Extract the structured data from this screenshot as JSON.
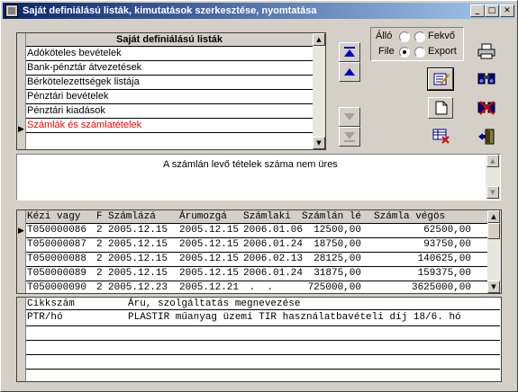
{
  "window": {
    "title": "Saját definiálású listák, kimutatások szerkesztése, nyomtatása",
    "controls": {
      "minimize": "_",
      "maximize": "□",
      "close": "✕"
    }
  },
  "lists": {
    "header": "Saját definiálású listák",
    "items": [
      "Adóköteles bevételek",
      "Bank-pénztár átvezetések",
      "Bérkötelezettségek listája",
      "Pénztári bevételek",
      "Pénztári kiadások",
      "Számlák és számlatételek"
    ],
    "selected_index": 5
  },
  "output": {
    "allo_label": "Álló",
    "fekvo_label": "Fekvő",
    "file_label": "File",
    "export_label": "Export",
    "orientation_selected": "Álló",
    "target_selected": "File"
  },
  "toolbar": {
    "icons": [
      "print-icon",
      "edit-icon",
      "binoculars-icon",
      "new-document-icon",
      "filter-binoculars-icon",
      "delete-record-icon",
      "exit-door-icon"
    ]
  },
  "memo": {
    "text": "A számlán levő tételek száma nem üres"
  },
  "invoices": {
    "columns": [
      "Kézi vagy",
      "F",
      "Számlázá",
      "Árumozgá",
      "Számlaki",
      "Számlán lé",
      "Számla végös"
    ],
    "rows": [
      [
        "T050000086",
        "2",
        "2005.12.15",
        "2005.12.15",
        "2006.01.06",
        "12500,00",
        "62500,00"
      ],
      [
        "T050000087",
        "2",
        "2005.12.15",
        "2005.12.15",
        "2006.01.24",
        "18750,00",
        "93750,00"
      ],
      [
        "T050000088",
        "2",
        "2005.12.15",
        "2005.12.15",
        "2006.02.13",
        "28125,00",
        "140625,00"
      ],
      [
        "T050000089",
        "2",
        "2005.12.15",
        "2005.12.15",
        "2006.01.24",
        "31875,00",
        "159375,00"
      ],
      [
        "T050000090",
        "2",
        "2005.12.23",
        "2005.12.21",
        " .  .",
        "725000,00",
        "3625000,00"
      ]
    ]
  },
  "items": {
    "columns": [
      "Cikkszám",
      "Áru, szolgáltatás megnevezése"
    ],
    "rows": [
      [
        "PTR/hó",
        "PLASTIR műanyag üzemi TIR használatbavételi díj 18/6. hó"
      ]
    ]
  }
}
